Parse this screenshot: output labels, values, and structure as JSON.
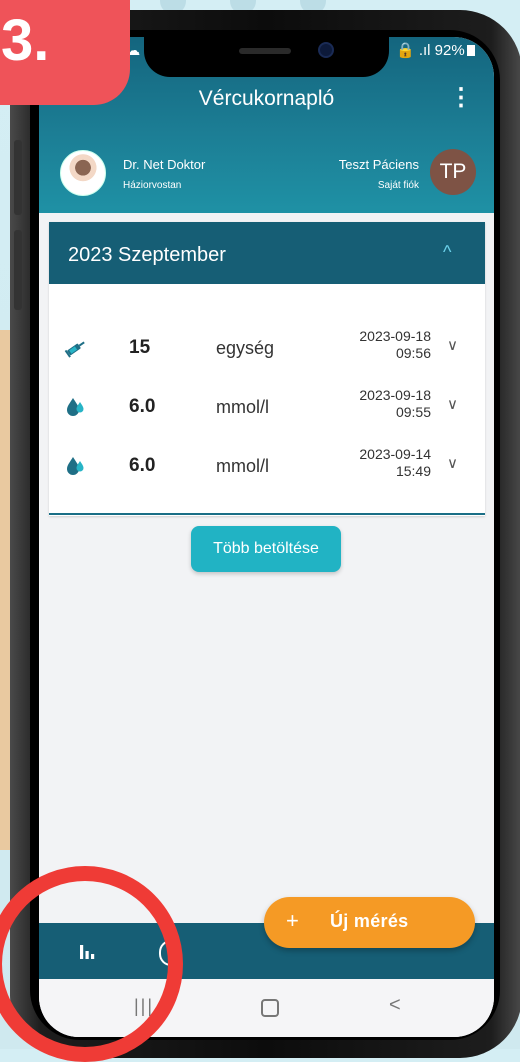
{
  "step_badge": "3.",
  "status": {
    "left": "▣ ☁",
    "right": "🔒 .ıl 92%"
  },
  "appbar": {
    "back_icon": "←",
    "title": "Vércukornapló",
    "menu_icon": "⋮"
  },
  "doctor": {
    "name": "Dr. Net Doktor",
    "role": "Háziorvostan"
  },
  "patient": {
    "name": "Teszt Páciens",
    "role": "Saját fiók",
    "initials": "TP"
  },
  "section": {
    "month": "2023 Szeptember",
    "collapse_icon": "^"
  },
  "entries": [
    {
      "icon": "syringe-icon",
      "value": "15",
      "unit": "egység",
      "date": "2023-09-18",
      "time": "09:56"
    },
    {
      "icon": "blood-drop-icon",
      "value": "6.0",
      "unit": "mmol/l",
      "date": "2023-09-18",
      "time": "09:55"
    },
    {
      "icon": "blood-drop-icon",
      "value": "6.0",
      "unit": "mmol/l",
      "date": "2023-09-14",
      "time": "15:49"
    }
  ],
  "load_more": "Több betöltése",
  "fab": {
    "plus": "+",
    "label": "Új mérés"
  },
  "bottom_nav": {
    "stats_icon": "bar-chart-icon"
  },
  "system_nav": {
    "recent": "|||",
    "back": "<"
  },
  "colors": {
    "header": "#165e75",
    "accent": "#21b3c4",
    "fab": "#f59a25",
    "highlight": "#ef3b36"
  }
}
